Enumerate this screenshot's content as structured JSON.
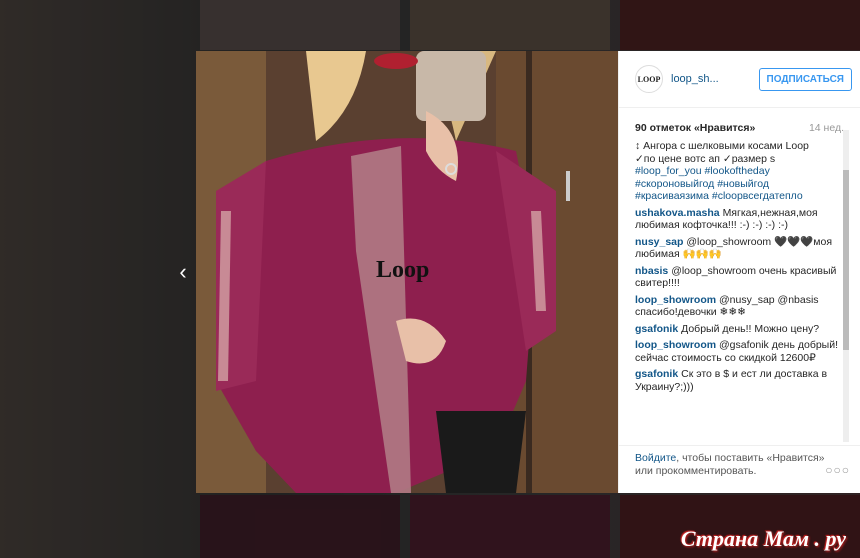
{
  "post": {
    "username": "loop_sh...",
    "avatar_text": "LOOP",
    "follow_label": "ПОДПИСАТЬСЯ",
    "likes": "90 отметок «Нравится»",
    "time": "14 нед.",
    "caption_lines": [
      "Ангора с шелковыми косами Loop",
      "✓по цене вотс ап ✓размер s",
      "#loop_for_you #lookoftheday",
      "#скороновыйгод #новыйгод",
      "#красиваязима #cloopвсегдатепло"
    ],
    "comments": [
      {
        "user": "ushakova.masha",
        "text": "Мягкая,нежная,моя любимая кофточка!!! :-) :-) :-) :-)"
      },
      {
        "user": "nusy_sap",
        "text": "@loop_showroom 🖤🖤🖤моя любимая 🙌🙌🙌"
      },
      {
        "user": "nbasis",
        "text": "@loop_showroom очень красивый свитер!!!!"
      },
      {
        "user": "loop_showroom",
        "text": "@nusy_sap @nbasis спасибо!девочки ❄❄❄"
      },
      {
        "user": "gsafonik",
        "text": "Добрый день!! Можно цену?"
      },
      {
        "user": "loop_showroom",
        "text": "@gsafonik день добрый!сейчас стоимость со скидкой 12600₽"
      },
      {
        "user": "gsafonik",
        "text": "Ск это в $ и ест ли доставка в Украину?;)))"
      }
    ],
    "footer_link": "Войдите",
    "footer_text": ", чтобы поставить «Нравится» или прокомментировать.",
    "more_icon": "more-dots-icon",
    "photo_logo": "Loop"
  },
  "nav": {
    "prev_icon": "‹"
  },
  "watermark": "Страна Мам . ру",
  "colors": {
    "link": "#125688",
    "follow": "#3897f0",
    "sweater": "#8e1f4e"
  }
}
